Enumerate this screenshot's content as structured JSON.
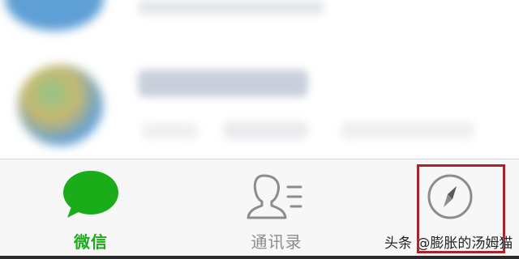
{
  "tabbar": {
    "tabs": [
      {
        "label": "微信",
        "icon": "chat-bubble-icon",
        "active": true,
        "color": "#1aad19"
      },
      {
        "label": "通讯录",
        "icon": "contacts-icon",
        "active": false,
        "color": "#8c8c8c"
      },
      {
        "label": "",
        "icon": "compass-icon",
        "active": false,
        "color": "#8c8c8c",
        "highlighted": true
      }
    ]
  },
  "colors": {
    "active_green": "#1aad19",
    "inactive_gray": "#8c8c8c",
    "highlight_red": "#a8232a",
    "tabbar_bg": "#f7f7f8"
  },
  "watermark": {
    "text": "头条 @膨胀的汤姆猫"
  }
}
